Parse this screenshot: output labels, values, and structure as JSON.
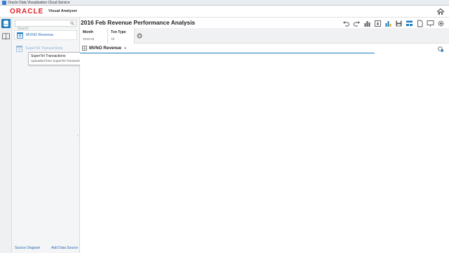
{
  "window": {
    "title": "Oracle Data Visualization Cloud Service"
  },
  "header": {
    "logo": "ORACLE",
    "product": "Visual Analyzer"
  },
  "icons": {
    "home": "home-icon",
    "data_rail": "database-icon",
    "viz_rail": "book-icon",
    "search": "search-icon"
  },
  "sidebar": {
    "search_placeholder": "Search",
    "data_sources": [
      {
        "label": "MVNO Revenue"
      },
      {
        "label": "SuperTel Transactions"
      }
    ],
    "tooltip": {
      "title": "SuperTel Transactions",
      "subtitle": "Uploaded from SuperTel Transactions.xlsx"
    },
    "bottom": {
      "source_diagram": "Source Diagram",
      "add_data_source": "Add Data Source"
    }
  },
  "canvas": {
    "title": "2016 Feb Revenue Performance Analysis",
    "toolbar": [
      "undo-icon",
      "redo-icon",
      "bar-chart-icon",
      "export-icon",
      "data-insights-icon",
      "save-icon",
      "hierarchy-icon",
      "document-icon",
      "presentation-icon",
      "settings-icon"
    ],
    "filters": [
      {
        "name": "Month",
        "value": "2016-03"
      },
      {
        "name": "Txn Type",
        "value": "All"
      }
    ],
    "viz": {
      "title": "MVNO Revenue"
    }
  },
  "colors": {
    "accent": "#1a7bbf",
    "brand_red": "#e11e26",
    "link": "#2a6cb0"
  }
}
